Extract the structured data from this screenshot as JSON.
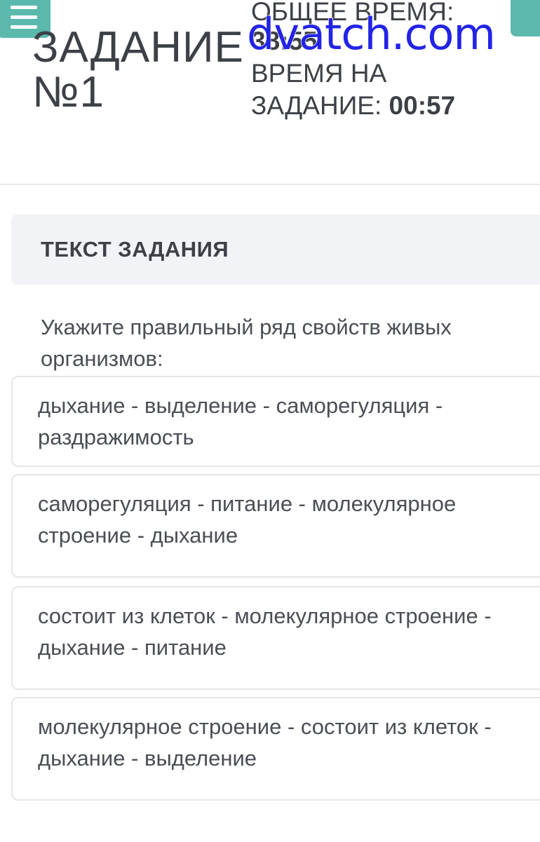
{
  "header": {
    "task_title_line1": "ЗАДАНИЕ",
    "task_title_line2": "№1",
    "total_time_label": "ОБЩЕЕ ВРЕМЯ:",
    "total_time_value": "38:55",
    "task_time_label_line1": "ВРЕМЯ НА",
    "task_time_label_line2": "ЗАДАНИЕ:",
    "task_time_value": "00:57"
  },
  "watermark": "dvatch.com",
  "section": {
    "title": "ТЕКСТ ЗАДАНИЯ"
  },
  "question": "Укажите правильный ряд свойств живых организмов:",
  "answers": [
    "дыхание - выделение - саморегуляция - раздражимость",
    "саморегуляция - питание - молекулярное строение - дыхание",
    "состоит из клеток - молекулярное строение - дыхание - питание",
    "молекулярное строение - состоит из клеток - дыхание - выделение"
  ],
  "colors": {
    "accent": "#5bb8ad",
    "text": "#3d4147",
    "watermark": "#2323e6",
    "section_bg": "#f1f3f7"
  },
  "icons": {
    "menu": "hamburger-menu-icon"
  }
}
